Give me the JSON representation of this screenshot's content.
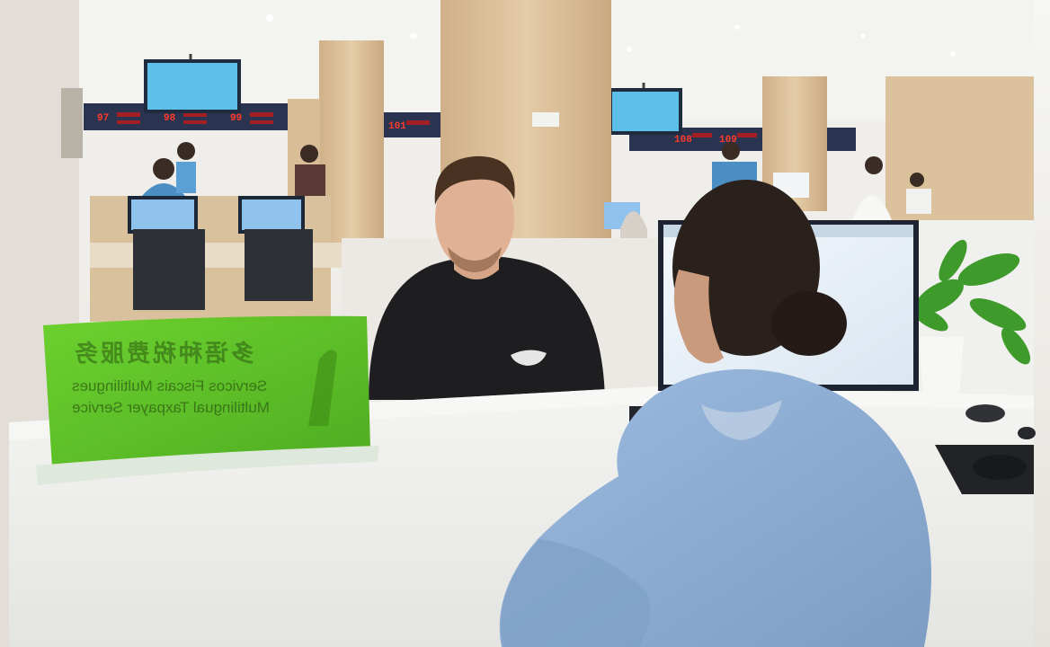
{
  "window_numbers": [
    "97",
    "98",
    "99",
    "101",
    "108",
    "109"
  ],
  "sign": {
    "line_chinese": "多语种税费服务",
    "line_1": "Servicos Fiscais Multilingues",
    "line_2": "Multilingual Taxpayer Service"
  },
  "colors": {
    "sign_green": "#5ac41e",
    "ceiling": "#f1f0ec",
    "wood": "#dcc29c",
    "counter": "#efefed",
    "uniform": "#8eaed2"
  }
}
